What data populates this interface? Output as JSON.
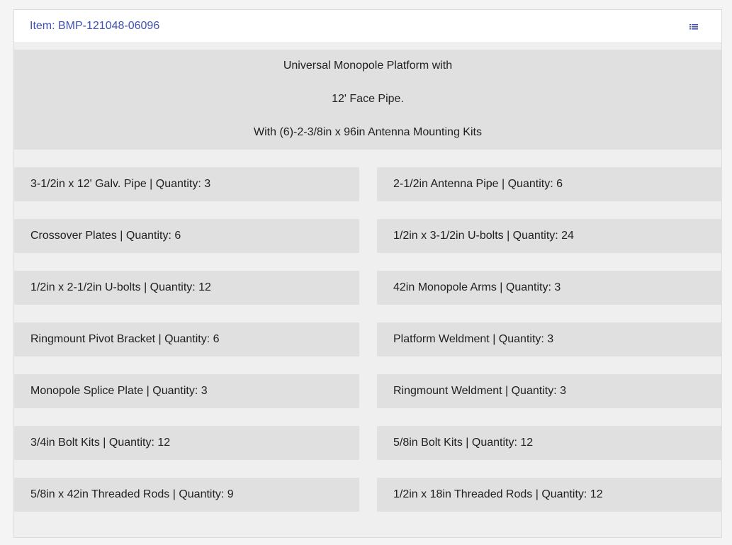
{
  "header": {
    "item_label": "Item: BMP-121048-06096",
    "menu_icon": "list-icon",
    "accent_color": "#3f51b5"
  },
  "description": {
    "line1": "Universal Monopole Platform with",
    "line2": "12' Face Pipe.",
    "line3": "With (6)-2-3/8in x 96in Antenna Mounting Kits"
  },
  "parts": [
    {
      "text": "3-1/2in x 12' Galv. Pipe | Quantity: 3"
    },
    {
      "text": "2-1/2in Antenna Pipe | Quantity: 6"
    },
    {
      "text": "Crossover Plates | Quantity: 6"
    },
    {
      "text": "1/2in x 3-1/2in U-bolts | Quantity: 24"
    },
    {
      "text": "1/2in x 2-1/2in U-bolts | Quantity: 12"
    },
    {
      "text": "42in Monopole Arms | Quantity: 3"
    },
    {
      "text": "Ringmount Pivot Bracket | Quantity: 6"
    },
    {
      "text": "Platform Weldment | Quantity: 3"
    },
    {
      "text": "Monopole Splice Plate | Quantity: 3"
    },
    {
      "text": "Ringmount Weldment | Quantity: 3"
    },
    {
      "text": "3/4in Bolt Kits | Quantity: 12"
    },
    {
      "text": "5/8in Bolt Kits | Quantity: 12"
    },
    {
      "text": "5/8in x 42in Threaded Rods | Quantity: 9"
    },
    {
      "text": "1/2in x 18in Threaded Rods | Quantity: 12"
    }
  ]
}
